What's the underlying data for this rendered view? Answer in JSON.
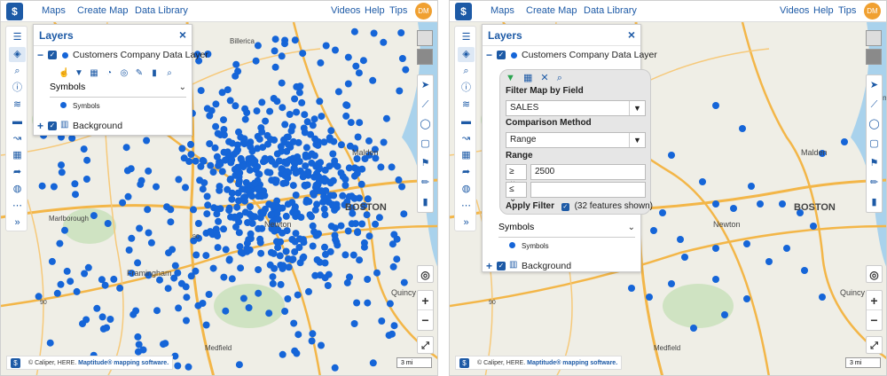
{
  "nav": {
    "logo": "$",
    "maps": "Maps",
    "create_map": "Create Map",
    "data_library": "Data Library",
    "videos": "Videos",
    "help": "Help",
    "tips": "Tips",
    "avatar": "DM"
  },
  "layers_panel": {
    "title": "Layers",
    "layer_name": "Customers Company Data Layer",
    "symbols_select": "Symbols",
    "symbols_item": "Symbols",
    "background": "Background"
  },
  "filter": {
    "field_label": "Filter Map by Field",
    "field_value": "SALES",
    "method_label": "Comparison Method",
    "method_value": "Range",
    "range_label": "Range",
    "op_min": "≥",
    "min_value": "2500",
    "op_max": "≤",
    "max_value": "",
    "apply_label": "Apply Filter",
    "features_shown": "(32 features shown)"
  },
  "map": {
    "places": {
      "boston": "BOSTON",
      "newton": "Newton",
      "malden": "Malden",
      "marlborough": "Marlborough",
      "framingham": "Framingham",
      "quincy": "Quincy",
      "medfield": "Medfield",
      "lynn": "Lyn",
      "billerica": "Billerica",
      "interstate": "90",
      "interstate2": "90"
    },
    "point_color": "#1565d8",
    "credits": "© Caliper, HERE.",
    "credits_brand": "Maptitude® mapping software.",
    "scale": "3 mi",
    "zoom_in": "+",
    "zoom_out": "−"
  }
}
